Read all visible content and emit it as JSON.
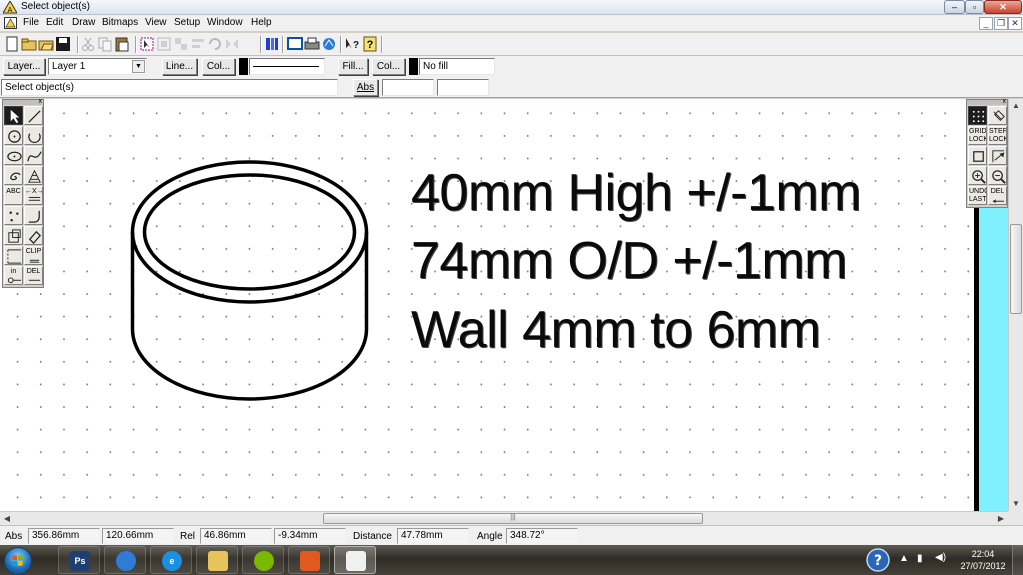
{
  "window": {
    "title": "Select object(s)",
    "controls": [
      "–",
      "▫",
      "✕"
    ],
    "mdi_controls": [
      "_",
      "❐",
      "✕"
    ]
  },
  "menu": {
    "items": [
      "File",
      "Edit",
      "Draw",
      "Bitmaps",
      "View",
      "Setup",
      "Window",
      "Help"
    ]
  },
  "toolbar": {
    "buttons": [
      {
        "name": "new-icon",
        "enabled": true
      },
      {
        "name": "open-icon",
        "enabled": true
      },
      {
        "name": "open-folder-icon",
        "enabled": true
      },
      {
        "name": "save-icon",
        "enabled": true
      },
      {
        "name": "cut-icon",
        "enabled": false
      },
      {
        "name": "copy-icon",
        "enabled": false
      },
      {
        "name": "paste-icon",
        "enabled": true
      },
      {
        "name": "select-all-icon",
        "enabled": true
      },
      {
        "name": "group-icon",
        "enabled": false
      },
      {
        "name": "ungroup-icon",
        "enabled": false
      },
      {
        "name": "align-icon",
        "enabled": false
      },
      {
        "name": "rotate-icon",
        "enabled": false
      },
      {
        "name": "mirror-icon",
        "enabled": false
      },
      {
        "name": "layers-icon",
        "enabled": true
      },
      {
        "name": "preview-icon",
        "enabled": true
      },
      {
        "name": "print-icon",
        "enabled": true
      },
      {
        "name": "plot-icon",
        "enabled": true
      },
      {
        "name": "context-help-icon",
        "enabled": true
      },
      {
        "name": "help-icon",
        "enabled": true
      }
    ]
  },
  "properties": {
    "layer_button": "Layer...",
    "layer_value": "Layer 1",
    "line_button": "Line...",
    "line_color_button": "Col...",
    "fill_button": "Fill...",
    "fill_color_button": "Col...",
    "fill_value": "No fill",
    "line_color": "#000000",
    "fill_color": "#000000"
  },
  "prompt": {
    "message": "Select object(s)",
    "abs_button": "Abs",
    "input_x": "",
    "input_y": ""
  },
  "drawing": {
    "text_lines": [
      "40mm High +/-1mm",
      "74mm O/D +/-1mm",
      "Wall 4mm to 6mm"
    ],
    "stroke_color": "#000000"
  },
  "left_palette": {
    "tools": [
      {
        "name": "select-arrow-icon",
        "label": ""
      },
      {
        "name": "line-icon",
        "label": ""
      },
      {
        "name": "circle-centre-icon",
        "label": ""
      },
      {
        "name": "arc-icon",
        "label": ""
      },
      {
        "name": "ellipse-icon",
        "label": ""
      },
      {
        "name": "curve-icon",
        "label": ""
      },
      {
        "name": "spiral-icon",
        "label": ""
      },
      {
        "name": "hatch-icon",
        "label": ""
      },
      {
        "name": "text-icon",
        "label": "ABC"
      },
      {
        "name": "dimension-icon",
        "label": "←X→"
      },
      {
        "name": "points-icon",
        "label": ""
      },
      {
        "name": "fillet-icon",
        "label": ""
      },
      {
        "name": "block-icon",
        "label": ""
      },
      {
        "name": "eraser-icon",
        "label": ""
      },
      {
        "name": "trim-icon",
        "label": ""
      },
      {
        "name": "clip-icon",
        "label": "CLIP"
      },
      {
        "name": "insert-icon",
        "label": "in"
      },
      {
        "name": "delete-icon",
        "label": "DEL"
      }
    ]
  },
  "right_palette": {
    "tools": [
      {
        "name": "grid-dots-icon",
        "label": ""
      },
      {
        "name": "snap-magnet-icon",
        "label": ""
      },
      {
        "name": "grid-lock-icon",
        "label": "GRID LOCK"
      },
      {
        "name": "step-lock-icon",
        "label": "STEP LOCK"
      },
      {
        "name": "window-zoom-icon",
        "label": ""
      },
      {
        "name": "zoom-extents-icon",
        "label": ""
      },
      {
        "name": "zoom-in-icon",
        "label": ""
      },
      {
        "name": "zoom-out-icon",
        "label": ""
      },
      {
        "name": "undo-last-icon",
        "label": "UNDO LAST"
      },
      {
        "name": "delete-last-icon",
        "label": "DEL"
      }
    ]
  },
  "coords": {
    "abs_label": "Abs",
    "abs_x": "356.86mm",
    "abs_y": "120.66mm",
    "rel_label": "Rel",
    "rel_x": "46.86mm",
    "rel_y": "-9.34mm",
    "distance_label": "Distance",
    "distance": "47.78mm",
    "angle_label": "Angle",
    "angle": "348.72°"
  },
  "taskbar": {
    "apps": [
      {
        "name": "photoshop-icon",
        "label": "Ps",
        "color": "#1e3f72",
        "active": false
      },
      {
        "name": "chrome-icon",
        "label": "",
        "color": "#2f7bd6",
        "active": false
      },
      {
        "name": "internet-explorer-icon",
        "label": "e",
        "color": "#1b8fe0",
        "active": false
      },
      {
        "name": "file-explorer-icon",
        "label": "",
        "color": "#e8c35a",
        "active": false
      },
      {
        "name": "spotify-icon",
        "label": "",
        "color": "#7ab800",
        "active": false
      },
      {
        "name": "office-icon",
        "label": "",
        "color": "#e05a20",
        "active": false
      },
      {
        "name": "cad-app-icon",
        "label": "",
        "color": "#f0f0f0",
        "active": true
      }
    ],
    "clock_time": "22:04",
    "clock_date": "27/07/2012"
  }
}
